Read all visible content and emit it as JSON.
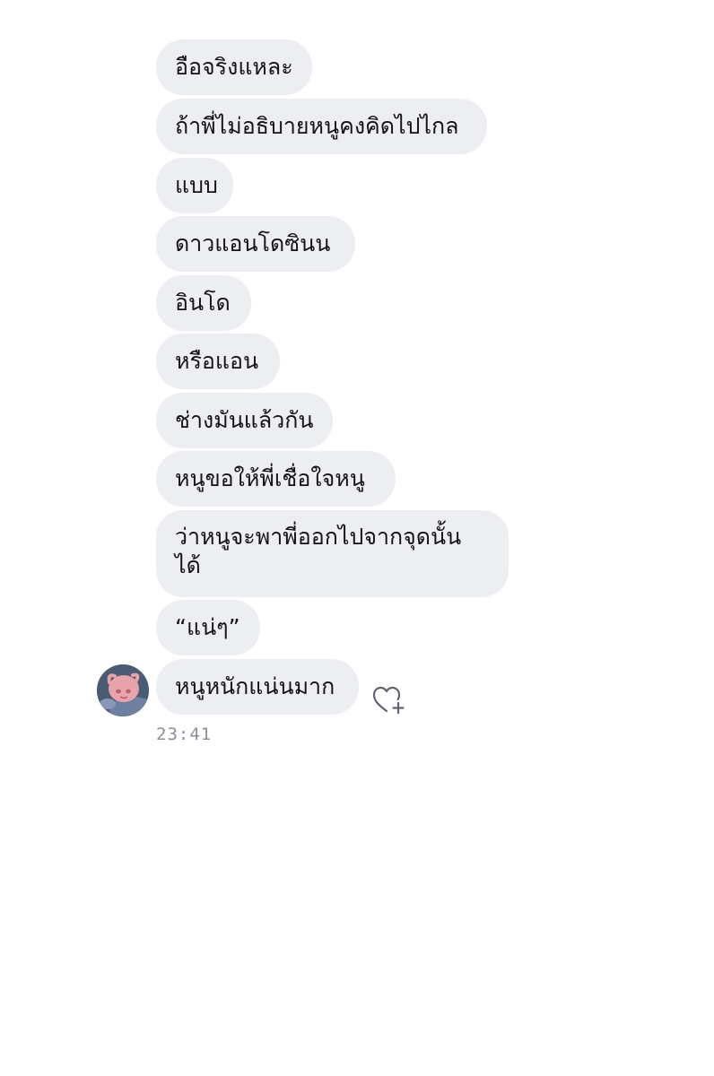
{
  "messages": [
    "อือจริงแหละ",
    "ถ้าพี่ไม่อธิบายหนูคงคิดไปไกล",
    "แบบ",
    "ดาวแอนโดซินน",
    "อินโด",
    "หรือแอน",
    "ช่างมันแล้วกัน",
    "หนูขอให้พี่เชื่อใจหนู",
    "ว่าหนูจะพาพี่ออกไปจากจุดนั้น ได้",
    "“แน่ๆ”",
    "หนูหนักแน่นมาก"
  ],
  "timestamp": "23:41",
  "icons": {
    "avatar": "avatar-cartoon",
    "like": "heart-plus-icon"
  },
  "colors": {
    "bubble": "#eceef2",
    "text": "#141414",
    "timestamp": "#8a8f98",
    "icon": "#5f6672"
  }
}
